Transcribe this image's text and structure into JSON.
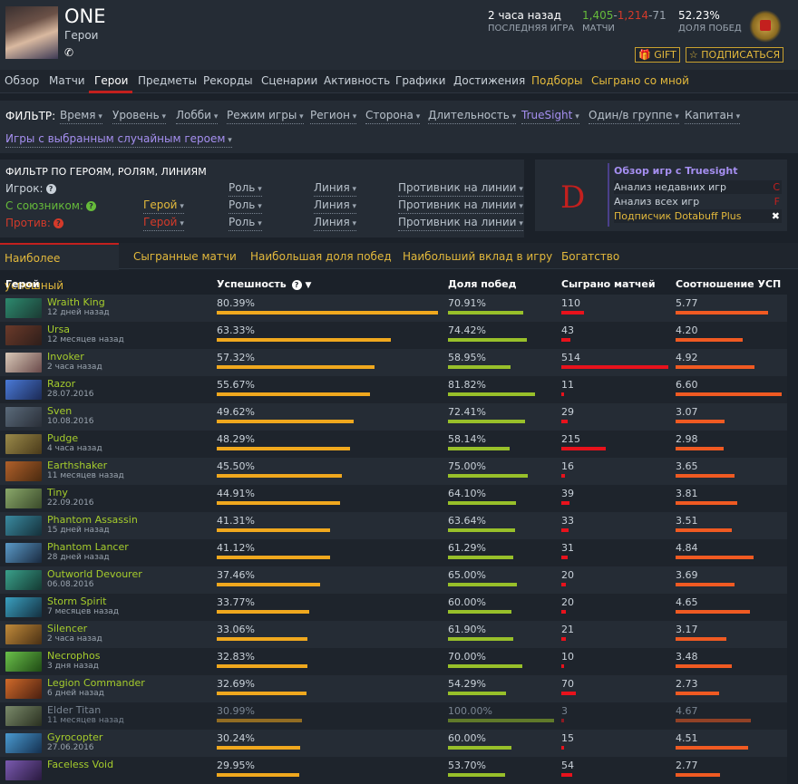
{
  "profile": {
    "name": "ONE",
    "sub": "Герои",
    "phone": "✆"
  },
  "stats": {
    "last_game": "2 часа назад",
    "last_game_label": "ПОСЛЕДНЯЯ ИГРА",
    "wins": "1,405",
    "losses": "1,214",
    "abandons": "71",
    "matches_label": "МАТЧИ",
    "winrate": "52.23%",
    "winrate_label": "ДОЛЯ ПОБЕД"
  },
  "buttons": {
    "gift": "🎁 GIFT",
    "subscribe": "☆ ПОДПИСАТЬСЯ"
  },
  "nav": [
    "Обзор",
    "Матчи",
    "Герои",
    "Предметы",
    "Рекорды",
    "Сценарии",
    "Активность",
    "Графики",
    "Достижения",
    "Подборы",
    "Сыграно со мной"
  ],
  "filter": {
    "label": "ФИЛЬТР:",
    "items": [
      "Время",
      "Уровень",
      "Лобби",
      "Режим игры",
      "Регион",
      "Сторона",
      "Длительность",
      "TrueSight",
      "Один/в группе",
      "Капитан",
      "Игры с выбранным случайным героем"
    ]
  },
  "hero_filter": {
    "title": "ФИЛЬТР ПО ГЕРОЯМ, РОЛЯМ, ЛИНИЯМ",
    "player": "Игрок:",
    "ally": "С союзником:",
    "enemy": "Против:",
    "hero": "Герой",
    "role": "Роль",
    "lane": "Линия",
    "opponent": "Противник на линии"
  },
  "truesight": {
    "grade": "D",
    "title": "Обзор игр с Truesight",
    "recent": "Анализ недавних игр",
    "recent_grade": "C",
    "all": "Анализ всех игр",
    "all_grade": "F",
    "plus": "Подписчик Dotabuff Plus",
    "close": "✖"
  },
  "tabs": [
    "Наиболее успешный",
    "Сыгранные матчи",
    "Наибольшая доля побед",
    "Наибольший вклад в игру",
    "Богатство"
  ],
  "table": {
    "headers": {
      "hero": "Герой",
      "success": "Успешность",
      "winrate": "Доля побед",
      "played": "Сыграно матчей",
      "kda": "Соотношение УСП"
    },
    "rows": [
      {
        "name": "Wraith King",
        "date": "12 дней назад",
        "success": "80.39%",
        "s": 80.39,
        "winrate": "70.91%",
        "w": 70.91,
        "played": "110",
        "p": 110,
        "kda": "5.77",
        "k": 5.77,
        "c1": "#2d8a6e",
        "c2": "#1b3a33"
      },
      {
        "name": "Ursa",
        "date": "12 месяцев назад",
        "success": "63.33%",
        "s": 63.33,
        "winrate": "74.42%",
        "w": 74.42,
        "played": "43",
        "p": 43,
        "kda": "4.20",
        "k": 4.2,
        "c1": "#6b3a2a",
        "c2": "#2e1e1a"
      },
      {
        "name": "Invoker",
        "date": "2 часа назад",
        "success": "57.32%",
        "s": 57.32,
        "winrate": "58.95%",
        "w": 58.95,
        "played": "514",
        "p": 514,
        "kda": "4.92",
        "k": 4.92,
        "c1": "#d9c9b8",
        "c2": "#6a4a4a"
      },
      {
        "name": "Razor",
        "date": "28.07.2016",
        "success": "55.67%",
        "s": 55.67,
        "winrate": "81.82%",
        "w": 81.82,
        "played": "11",
        "p": 11,
        "kda": "6.60",
        "k": 6.6,
        "c1": "#4a7ad8",
        "c2": "#1c2a55"
      },
      {
        "name": "Sven",
        "date": "10.08.2016",
        "success": "49.62%",
        "s": 49.62,
        "winrate": "72.41%",
        "w": 72.41,
        "played": "29",
        "p": 29,
        "kda": "3.07",
        "k": 3.07,
        "c1": "#5a6a7a",
        "c2": "#2a2f38"
      },
      {
        "name": "Pudge",
        "date": "4 часа назад",
        "success": "48.29%",
        "s": 48.29,
        "winrate": "58.14%",
        "w": 58.14,
        "played": "215",
        "p": 215,
        "kda": "2.98",
        "k": 2.98,
        "c1": "#9a8a4a",
        "c2": "#4a3a1a"
      },
      {
        "name": "Earthshaker",
        "date": "11 месяцев назад",
        "success": "45.50%",
        "s": 45.5,
        "winrate": "75.00%",
        "w": 75.0,
        "played": "16",
        "p": 16,
        "kda": "3.65",
        "k": 3.65,
        "c1": "#b0602a",
        "c2": "#4a2a10"
      },
      {
        "name": "Tiny",
        "date": "22.09.2016",
        "success": "44.91%",
        "s": 44.91,
        "winrate": "64.10%",
        "w": 64.1,
        "played": "39",
        "p": 39,
        "kda": "3.81",
        "k": 3.81,
        "c1": "#8aa86a",
        "c2": "#3a4a2a"
      },
      {
        "name": "Phantom Assassin",
        "date": "15 дней назад",
        "success": "41.31%",
        "s": 41.31,
        "winrate": "63.64%",
        "w": 63.64,
        "played": "33",
        "p": 33,
        "kda": "3.51",
        "k": 3.51,
        "c1": "#3a8aa0",
        "c2": "#15303a"
      },
      {
        "name": "Phantom Lancer",
        "date": "28 дней назад",
        "success": "41.12%",
        "s": 41.12,
        "winrate": "61.29%",
        "w": 61.29,
        "played": "31",
        "p": 31,
        "kda": "4.84",
        "k": 4.84,
        "c1": "#5a9ac8",
        "c2": "#1a2a40"
      },
      {
        "name": "Outworld Devourer",
        "date": "06.08.2016",
        "success": "37.46%",
        "s": 37.46,
        "winrate": "65.00%",
        "w": 65.0,
        "played": "20",
        "p": 20,
        "kda": "3.69",
        "k": 3.69,
        "c1": "#3aa08a",
        "c2": "#143a33"
      },
      {
        "name": "Storm Spirit",
        "date": "7 месяцев назад",
        "success": "33.77%",
        "s": 33.77,
        "winrate": "60.00%",
        "w": 60.0,
        "played": "20",
        "p": 20,
        "kda": "4.65",
        "k": 4.65,
        "c1": "#3aa0c0",
        "c2": "#143040"
      },
      {
        "name": "Silencer",
        "date": "2 часа назад",
        "success": "33.06%",
        "s": 33.06,
        "winrate": "61.90%",
        "w": 61.9,
        "played": "21",
        "p": 21,
        "kda": "3.17",
        "k": 3.17,
        "c1": "#c08a3a",
        "c2": "#4a3014"
      },
      {
        "name": "Necrophos",
        "date": "3 дня назад",
        "success": "32.83%",
        "s": 32.83,
        "winrate": "70.00%",
        "w": 70.0,
        "played": "10",
        "p": 10,
        "kda": "3.48",
        "k": 3.48,
        "c1": "#6ac04a",
        "c2": "#1f4a14"
      },
      {
        "name": "Legion Commander",
        "date": "6 дней назад",
        "success": "32.69%",
        "s": 32.69,
        "winrate": "54.29%",
        "w": 54.29,
        "played": "70",
        "p": 70,
        "kda": "2.73",
        "k": 2.73,
        "c1": "#d06a2a",
        "c2": "#4a1f10"
      },
      {
        "name": "Elder Titan",
        "date": "11 месяцев назад",
        "success": "30.99%",
        "s": 30.99,
        "winrate": "100.00%",
        "w": 100.0,
        "played": "3",
        "p": 3,
        "kda": "4.67",
        "k": 4.67,
        "c1": "#7a8a6a",
        "c2": "#2a3020",
        "dim": true
      },
      {
        "name": "Gyrocopter",
        "date": "27.06.2016",
        "success": "30.24%",
        "s": 30.24,
        "winrate": "60.00%",
        "w": 60.0,
        "played": "15",
        "p": 15,
        "kda": "4.51",
        "k": 4.51,
        "c1": "#4a9ad0",
        "c2": "#143050"
      },
      {
        "name": "Faceless Void",
        "date": "",
        "success": "29.95%",
        "s": 29.95,
        "winrate": "53.70%",
        "w": 53.7,
        "played": "54",
        "p": 54,
        "kda": "2.77",
        "k": 2.77,
        "c1": "#7a5ab0",
        "c2": "#2a1a40"
      }
    ]
  },
  "colors": {
    "success_bar": "#f0a81e",
    "winrate_bar": "#98c02a",
    "played_bar": "#e8121c",
    "kda_bar": "#f05a22",
    "accent": "#c3201e",
    "gold": "#e3b93c"
  }
}
